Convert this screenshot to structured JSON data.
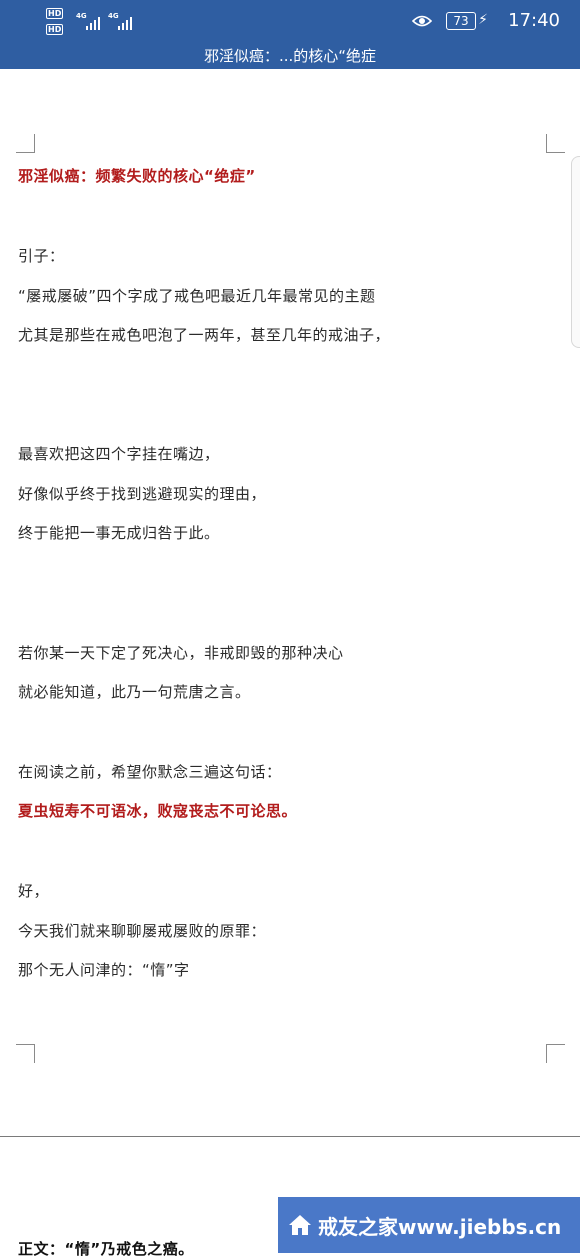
{
  "status_bar": {
    "sim1_label": "HD",
    "sim2_label": "HD",
    "network1": "4G",
    "network2": "4G",
    "battery_level": "73",
    "time": "17:40"
  },
  "document": {
    "title_bar": "邪淫似癌：...的核心“绝症",
    "lines": [
      "邪淫似癌：频繁失败的核心“绝症”",
      "引子：",
      "“屡戒屡破”四个字成了戒色吧最近几年最常见的主题",
      "尤其是那些在戒色吧泡了一两年，甚至几年的戒油子，",
      "最喜欢把这四个字挂在嘴边，",
      "好像似乎终于找到逃避现实的理由，",
      "终于能把一事无成归咎于此。",
      "若你某一天下定了死决心，非戒即毁的那种决心",
      "就必能知道，此乃一句荒唐之言。",
      "在阅读之前，希望你默念三遍这句话：",
      "夏虫短寿不可语冰，败寇丧志不可论思。",
      "好，",
      "今天我们就来聊聊屡戒屡败的原罪：",
      "那个无人问津的：“惰”字",
      "正文：“惰”乃戒色之癌。"
    ]
  },
  "watermark": {
    "text": "戒友之家www.jiebbs.cn",
    "color": "#4a78c8"
  }
}
